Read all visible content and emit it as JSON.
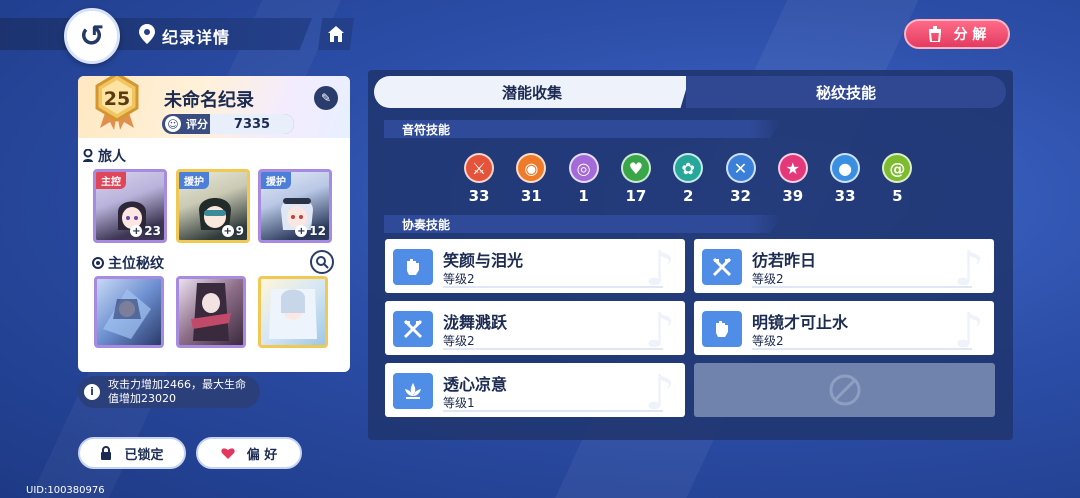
{
  "header": {
    "page_title": "纪录详情",
    "decompose_label": "分 解"
  },
  "record": {
    "level": "25",
    "name": "未命名纪录",
    "score_label": "评分",
    "score_value": "7335"
  },
  "travelers": {
    "label": "旅人",
    "members": [
      {
        "tag": "主控",
        "level": "23",
        "tag_color": "#e0465a",
        "frame": "#a78be0"
      },
      {
        "tag": "援护",
        "level": "9",
        "tag_color": "#4c7fd8",
        "frame": "#f0c955"
      },
      {
        "tag": "援护",
        "level": "12",
        "tag_color": "#4c7fd8",
        "frame": "#a78be0"
      }
    ]
  },
  "main_glyphs": {
    "label": "主位秘纹",
    "frames": [
      "#a78be0",
      "#a78be0",
      "#f0c955"
    ]
  },
  "info_text": "攻击力增加2466，最大生命值增加23020",
  "buttons": {
    "locked_label": "已锁定",
    "favorite_label": "偏 好"
  },
  "uid_text": "UID:100380976",
  "tabs": [
    {
      "label": "潜能收集",
      "active": true
    },
    {
      "label": "秘纹技能",
      "active": false
    }
  ],
  "note_skills": {
    "label": "音符技能",
    "notes": [
      {
        "count": "33",
        "color": "#e5533a",
        "icon": "sword-note-icon"
      },
      {
        "count": "31",
        "color": "#ee7a2a",
        "icon": "eye-note-icon"
      },
      {
        "count": "1",
        "color": "#a46bd8",
        "icon": "ring-note-icon"
      },
      {
        "count": "17",
        "color": "#3aa64a",
        "icon": "heart-note-icon"
      },
      {
        "count": "2",
        "color": "#25a89a",
        "icon": "leaf-note-icon"
      },
      {
        "count": "32",
        "color": "#3a7fd8",
        "icon": "cross-swords-note-icon"
      },
      {
        "count": "39",
        "color": "#e4387a",
        "icon": "star-note-icon"
      },
      {
        "count": "33",
        "color": "#3b8fe0",
        "icon": "drop-note-icon"
      },
      {
        "count": "5",
        "color": "#7cbc2e",
        "icon": "swirl-note-icon"
      }
    ]
  },
  "ensemble_skills": {
    "label": "协奏技能",
    "skills": [
      {
        "name": "笑颜与泪光",
        "level": "等级2",
        "icon": "fist-icon"
      },
      {
        "name": "彷若昨日",
        "level": "等级2",
        "icon": "crossed-swords-icon"
      },
      {
        "name": "泷舞溅跃",
        "level": "等级2",
        "icon": "crossed-swords-icon"
      },
      {
        "name": "明镜才可止水",
        "level": "等级2",
        "icon": "fist-icon"
      },
      {
        "name": "透心凉意",
        "level": "等级1",
        "icon": "lotus-icon"
      }
    ]
  },
  "colors": {
    "accent": "#2b3f7a",
    "decompose": "#e33c61",
    "skill_icon": "#4f8de6"
  }
}
